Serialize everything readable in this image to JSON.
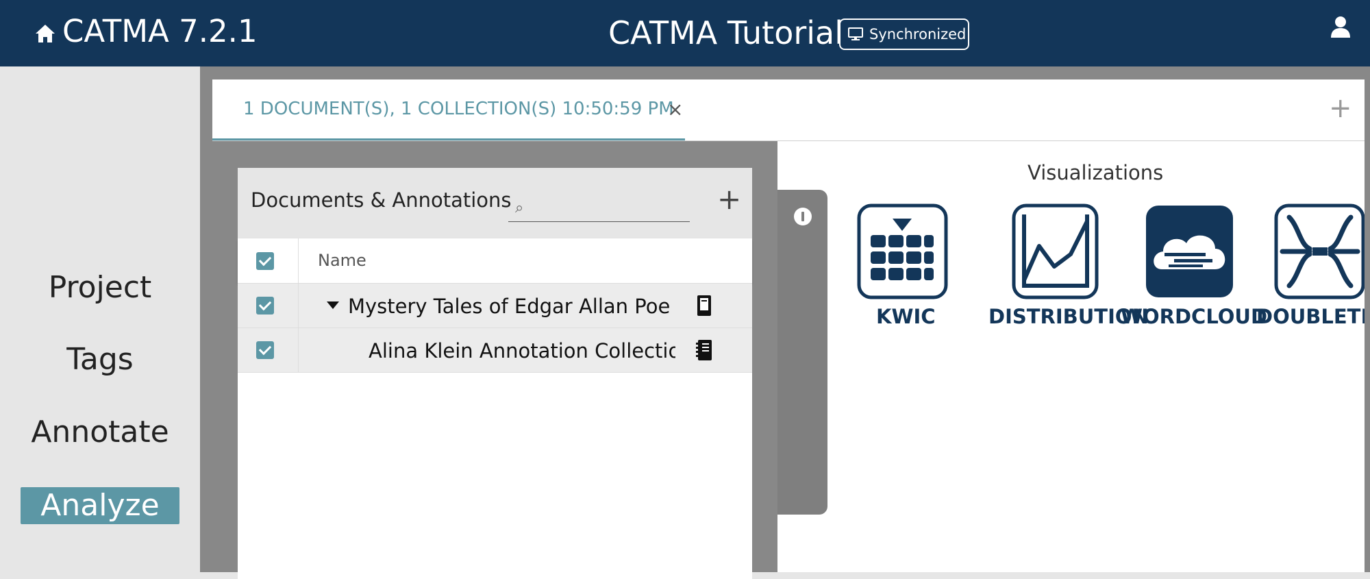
{
  "header": {
    "app_title": "CATMA 7.2.1",
    "project_title": "CATMA Tutorial",
    "sync_status": "Synchronized",
    "icons": [
      "home-icon",
      "monitor-icon",
      "user-icon"
    ]
  },
  "sidenav": {
    "items": [
      {
        "label": "Project"
      },
      {
        "label": "Tags"
      },
      {
        "label": "Annotate"
      },
      {
        "label": "Analyze",
        "active": true
      }
    ]
  },
  "tabs": [
    {
      "label": "1 DOCUMENT(S), 1 COLLECTION(S) 10:50:59 PM",
      "close": "×"
    }
  ],
  "tab_add": "+",
  "documents_panel": {
    "title": "Documents & Annotations",
    "search_placeholder": "",
    "search_icon": "⌕",
    "add": "+",
    "columns": [
      "Name"
    ],
    "rows": [
      {
        "name": "Mystery Tales of Edgar Allan Poe Th",
        "checked": true,
        "type": "document",
        "expanded": true
      },
      {
        "name": "Alina Klein Annotation Collection",
        "checked": true,
        "type": "collection"
      }
    ]
  },
  "visualizations": {
    "title": "Visualizations",
    "items": [
      {
        "label": "KWIC",
        "icon": "kwic-icon"
      },
      {
        "label": "DISTRIBUTION",
        "icon": "distribution-icon"
      },
      {
        "label": "WORDCLOUD",
        "icon": "wordcloud-icon"
      },
      {
        "label": "DOUBLETR",
        "icon": "doubletree-icon"
      }
    ]
  },
  "colors": {
    "header_bg": "#133659",
    "accent": "#5c97a5",
    "viz_icon": "#133659"
  }
}
